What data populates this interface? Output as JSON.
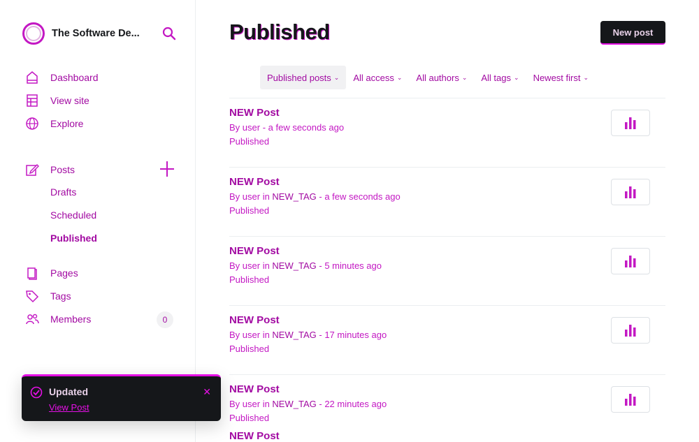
{
  "brand": {
    "name": "The Software De..."
  },
  "nav": {
    "dashboard": "Dashboard",
    "view_site": "View site",
    "explore": "Explore",
    "posts": "Posts",
    "drafts": "Drafts",
    "scheduled": "Scheduled",
    "published": "Published",
    "pages": "Pages",
    "tags": "Tags",
    "members": "Members",
    "members_count": "0"
  },
  "toast": {
    "title": "Updated",
    "link": "View Post"
  },
  "main": {
    "title": "Published",
    "new_post": "New post",
    "filters": [
      "Published posts",
      "All access",
      "All authors",
      "All tags",
      "Newest first"
    ]
  },
  "posts": [
    {
      "title": "NEW Post",
      "author": "By user",
      "tag": "",
      "time": "a few seconds ago",
      "status": "Published"
    },
    {
      "title": "NEW Post",
      "author": "By user",
      "tag": "NEW_TAG",
      "time": "a few seconds ago",
      "status": "Published"
    },
    {
      "title": "NEW Post",
      "author": "By user",
      "tag": "NEW_TAG",
      "time": "5 minutes ago",
      "status": "Published"
    },
    {
      "title": "NEW Post",
      "author": "By user",
      "tag": "NEW_TAG",
      "time": "17 minutes ago",
      "status": "Published"
    },
    {
      "title": "NEW Post",
      "author": "By user",
      "tag": "NEW_TAG",
      "time": "22 minutes ago",
      "status": "Published"
    },
    {
      "title": "NEW Post",
      "author": "",
      "tag": "",
      "time": "",
      "status": ""
    }
  ],
  "colors": {
    "accent": "#c318c3",
    "text": "#15171a",
    "link": "#a20aa2"
  },
  "icons": [
    "home-icon",
    "view-site-icon",
    "globe-icon",
    "posts-icon",
    "plus-icon",
    "pages-icon",
    "tag-icon",
    "members-icon",
    "search-icon",
    "check-circle-icon",
    "close-icon",
    "stats-icon",
    "chevron-down-icon"
  ]
}
